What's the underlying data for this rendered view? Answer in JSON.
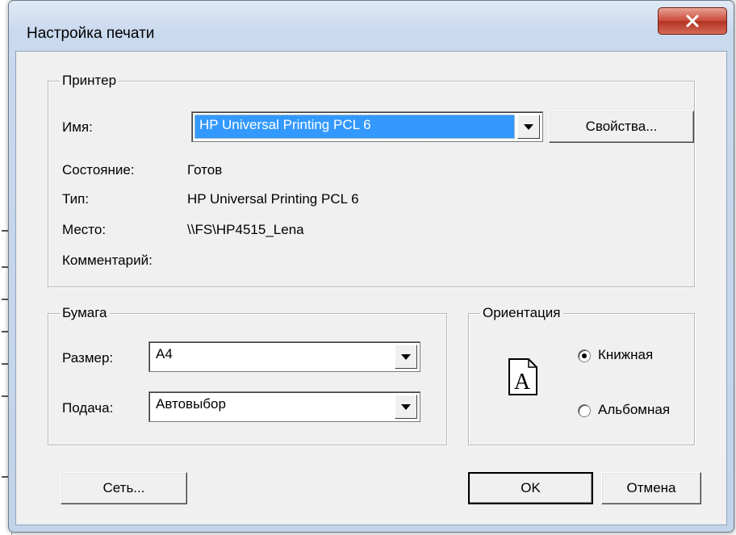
{
  "window": {
    "title": "Настройка печати",
    "close_glyph": "X"
  },
  "printer": {
    "legend": "Принтер",
    "name_label": "Имя:",
    "name_value": "HP Universal Printing PCL 6",
    "properties_button": "Свойства...",
    "status_label": "Состояние:",
    "status_value": "Готов",
    "type_label": "Тип:",
    "type_value": "HP Universal Printing PCL 6",
    "location_label": "Место:",
    "location_value": "\\\\FS\\HP4515_Lena",
    "comment_label": "Комментарий:"
  },
  "paper": {
    "legend": "Бумага",
    "size_label": "Размер:",
    "size_value": "A4",
    "source_label": "Подача:",
    "source_value": "Автовыбор"
  },
  "orientation": {
    "legend": "Ориентация",
    "icon_letter": "A",
    "portrait_label": "Книжная",
    "landscape_label": "Альбомная",
    "selected": "portrait"
  },
  "buttons": {
    "network": "Сеть...",
    "ok": "OK",
    "cancel": "Отмена"
  },
  "colors": {
    "selection": "#3399ff",
    "close_red": "#c9493a",
    "dialog_bg": "#f0f0f0"
  }
}
